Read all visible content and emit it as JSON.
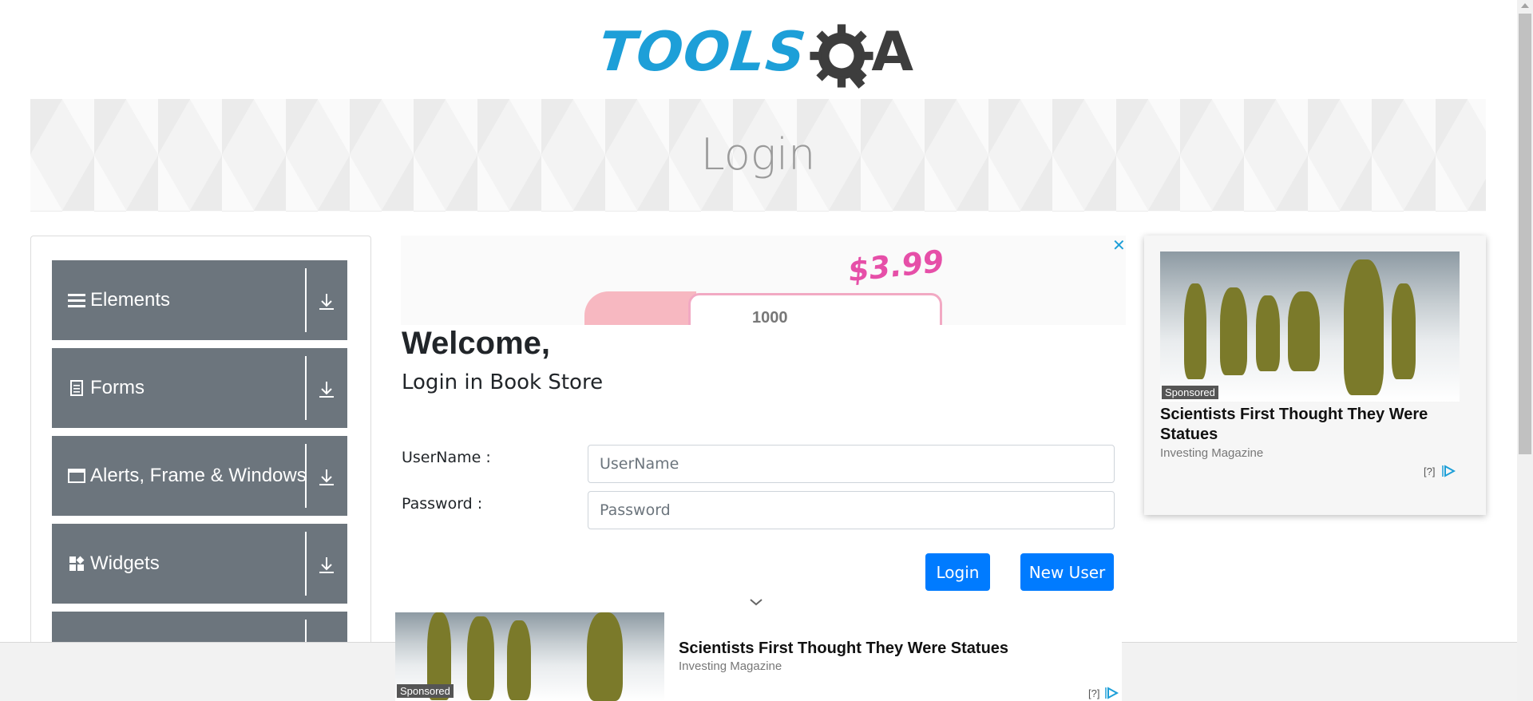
{
  "logo": {
    "text": "TOOLS",
    "suffix": "A"
  },
  "banner": {
    "title": "Login"
  },
  "sidebar": {
    "groups": [
      {
        "label": "Elements",
        "icon": "hamburger-icon"
      },
      {
        "label": "Forms",
        "icon": "document-icon"
      },
      {
        "label": "Alerts, Frame & Windows",
        "icon": "window-icon"
      },
      {
        "label": "Widgets",
        "icon": "widgets-icon"
      },
      {
        "label": "",
        "icon": ""
      }
    ]
  },
  "top_ad": {
    "price": "$3.99",
    "quantity": "1000",
    "close": "✕"
  },
  "form": {
    "welcome": "Welcome,",
    "subtitle": "Login in Book Store",
    "username_label": "UserName :",
    "username_placeholder": "UserName",
    "password_label": "Password :",
    "password_placeholder": "Password",
    "login_button": "Login",
    "new_user_button": "New User"
  },
  "right_ad": {
    "sponsored": "Sponsored",
    "title": "Scientists First Thought They Were Statues",
    "source": "Investing Magazine",
    "info": "[?]"
  },
  "bottom_ad": {
    "sponsored": "Sponsored",
    "title": "Scientists First Thought They Were Statues",
    "source": "Investing Magazine",
    "info": "[?]"
  },
  "colors": {
    "brand_blue": "#1d9fd8",
    "primary": "#007bff",
    "sidebar_group": "#6c757d"
  }
}
